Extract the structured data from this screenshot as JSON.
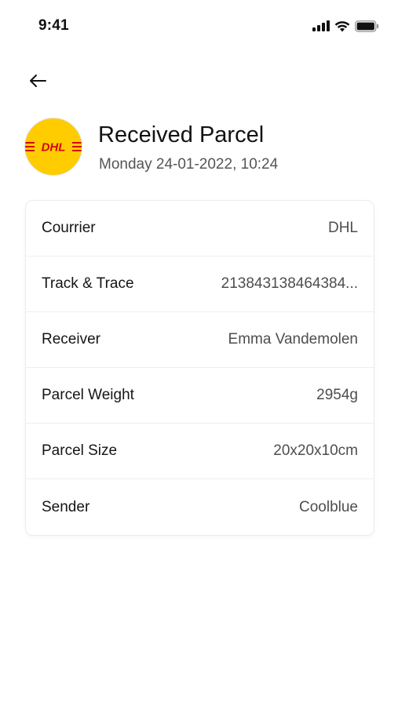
{
  "status_bar": {
    "time": "9:41",
    "icons": [
      "cellular-signal-icon",
      "wifi-icon",
      "battery-icon"
    ]
  },
  "navigation": {
    "back_icon": "arrow-left-icon"
  },
  "header": {
    "logo_text": "DHL",
    "title": "Received Parcel",
    "subtitle": "Monday 24-01-2022, 10:24"
  },
  "colors": {
    "dhl_yellow": "#ffcc00",
    "dhl_red": "#d40511"
  },
  "details": [
    {
      "label": "Courrier",
      "value": "DHL"
    },
    {
      "label": "Track & Trace",
      "value": "213843138464384..."
    },
    {
      "label": "Receiver",
      "value": "Emma Vandemolen"
    },
    {
      "label": "Parcel Weight",
      "value": "2954g"
    },
    {
      "label": "Parcel Size",
      "value": "20x20x10cm"
    },
    {
      "label": "Sender",
      "value": "Coolblue"
    }
  ]
}
